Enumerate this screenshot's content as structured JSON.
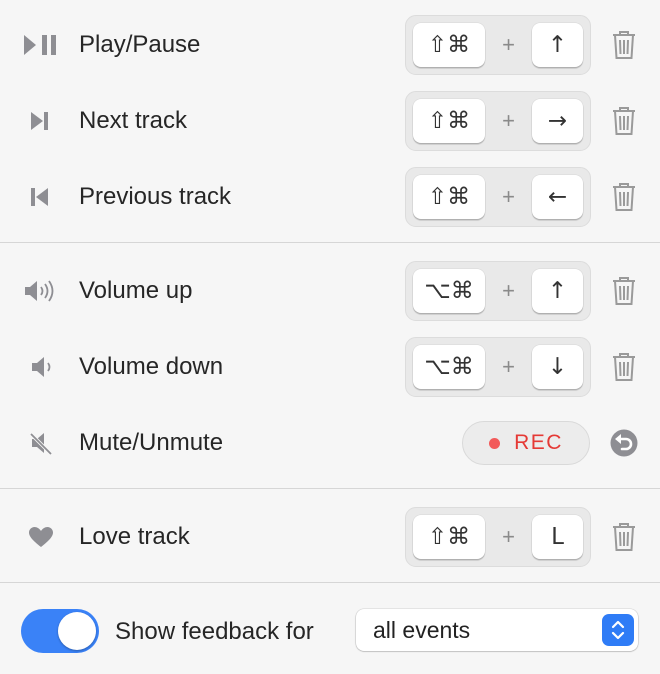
{
  "shortcuts": [
    {
      "label": "Play/Pause",
      "icon": "play-pause-icon",
      "mods": "⇧⌘",
      "plus": "+",
      "key": "↑"
    },
    {
      "label": "Next track",
      "icon": "next-track-icon",
      "mods": "⇧⌘",
      "plus": "+",
      "key": "→"
    },
    {
      "label": "Previous track",
      "icon": "previous-track-icon",
      "mods": "⇧⌘",
      "plus": "+",
      "key": "←"
    },
    {
      "label": "Volume up",
      "icon": "volume-up-icon",
      "mods": "⌥⌘",
      "plus": "+",
      "key": "↑"
    },
    {
      "label": "Volume down",
      "icon": "volume-down-icon",
      "mods": "⌥⌘",
      "plus": "+",
      "key": "↓"
    },
    {
      "label": "Mute/Unmute",
      "icon": "mute-icon",
      "record": "REC"
    },
    {
      "label": "Love track",
      "icon": "heart-icon",
      "mods": "⇧⌘",
      "plus": "+",
      "key": "L"
    }
  ],
  "footer": {
    "toggle_on": true,
    "feedback_label": "Show feedback for",
    "feedback_value": "all events"
  },
  "colors": {
    "accent": "#3a82f7",
    "record": "#e53935",
    "icon_gray": "#8e8e93"
  }
}
